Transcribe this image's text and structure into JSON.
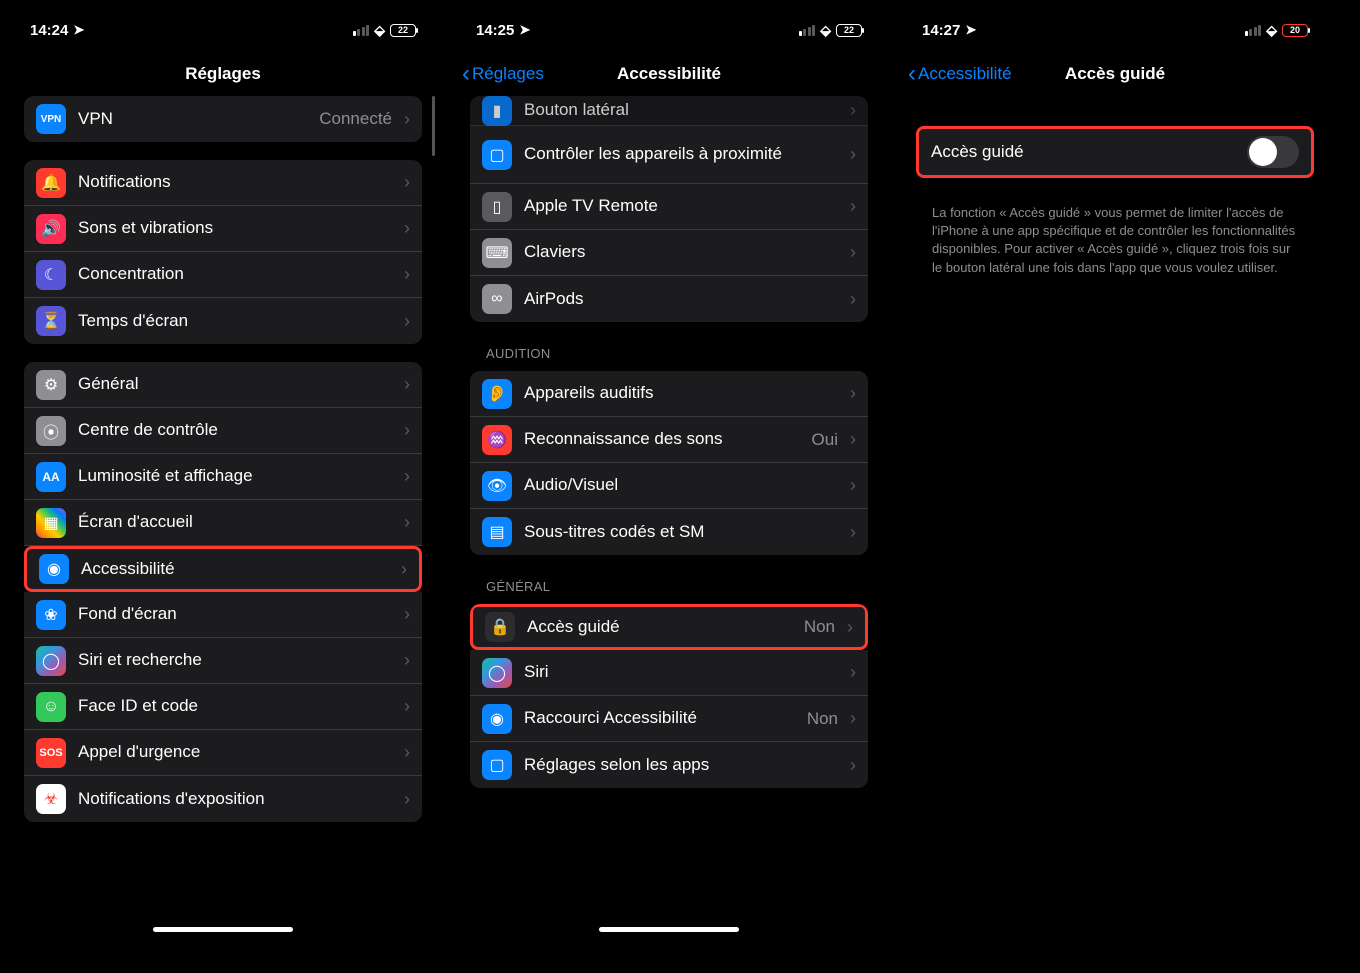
{
  "phones": [
    {
      "time": "14:24",
      "battery": "22",
      "battery_red": false,
      "back": null,
      "title": "Réglages",
      "vpn": {
        "label": "VPN",
        "value": "Connecté"
      },
      "groups": [
        {
          "header": null,
          "rows": [
            {
              "icon": "bell-icon",
              "bg": "bg-red",
              "glyph": "🔔",
              "label": "Notifications"
            },
            {
              "icon": "speaker-icon",
              "bg": "bg-pink",
              "glyph": "🔊",
              "label": "Sons et vibrations"
            },
            {
              "icon": "moon-icon",
              "bg": "bg-purple",
              "glyph": "☾",
              "label": "Concentration"
            },
            {
              "icon": "hourglass-icon",
              "bg": "bg-purple",
              "glyph": "⏳",
              "label": "Temps d'écran"
            }
          ]
        },
        {
          "header": null,
          "rows": [
            {
              "icon": "gear-icon",
              "bg": "bg-gray",
              "glyph": "⚙",
              "label": "Général"
            },
            {
              "icon": "control-center-icon",
              "bg": "bg-gray",
              "glyph": "⦿",
              "label": "Centre de contrôle"
            },
            {
              "icon": "brightness-icon",
              "bg": "bg-blue",
              "glyph": "AA",
              "label": "Luminosité et affichage"
            },
            {
              "icon": "home-screen-icon",
              "bg": "bg-white-dots",
              "glyph": "▦",
              "label": "Écran d'accueil"
            },
            {
              "icon": "accessibility-icon",
              "bg": "bg-blue",
              "glyph": "◉",
              "label": "Accessibilité",
              "highlight": true
            },
            {
              "icon": "wallpaper-icon",
              "bg": "bg-atom",
              "glyph": "❀",
              "label": "Fond d'écran"
            },
            {
              "icon": "siri-icon",
              "bg": "bg-siri",
              "glyph": "◯",
              "label": "Siri et recherche"
            },
            {
              "icon": "faceid-icon",
              "bg": "bg-green",
              "glyph": "☺",
              "label": "Face ID et code"
            },
            {
              "icon": "sos-icon",
              "bg": "bg-sos",
              "glyph": "SOS",
              "label": "Appel d'urgence"
            },
            {
              "icon": "exposure-icon",
              "bg": "bg-red",
              "glyph": "◌",
              "label": "Notifications d'exposition"
            }
          ]
        }
      ]
    },
    {
      "time": "14:25",
      "battery": "22",
      "battery_red": false,
      "back": "Réglages",
      "title": "Accessibilité",
      "vpn": null,
      "groups": [
        {
          "header": null,
          "tight": true,
          "rows": [
            {
              "icon": "side-button-icon",
              "bg": "bg-blue",
              "glyph": "▮",
              "label": "Bouton latéral",
              "partial": true
            },
            {
              "icon": "nearby-icon",
              "bg": "bg-blue",
              "glyph": "▢",
              "label": "Contrôler les appareils\nà proximité",
              "tall": true
            },
            {
              "icon": "tv-remote-icon",
              "bg": "bg-dgray",
              "glyph": "▯",
              "label": "Apple TV Remote"
            },
            {
              "icon": "keyboard-icon",
              "bg": "bg-gray",
              "glyph": "⌨",
              "label": "Claviers"
            },
            {
              "icon": "airpods-icon",
              "bg": "bg-gray",
              "glyph": "∞",
              "label": "AirPods"
            }
          ]
        },
        {
          "header": "AUDITION",
          "rows": [
            {
              "icon": "hearing-icon",
              "bg": "bg-blue",
              "glyph": "👂",
              "label": "Appareils auditifs"
            },
            {
              "icon": "sound-recog-icon",
              "bg": "bg-red",
              "glyph": "♒",
              "label": "Reconnaissance des sons",
              "value": "Oui"
            },
            {
              "icon": "audio-visual-icon",
              "bg": "bg-blue",
              "glyph": "👁",
              "label": "Audio/Visuel"
            },
            {
              "icon": "subtitles-icon",
              "bg": "bg-blue",
              "glyph": "▤",
              "label": "Sous-titres codés et SM"
            }
          ]
        },
        {
          "header": "GÉNÉRAL",
          "rows": [
            {
              "icon": "lock-icon",
              "bg": "bg-black",
              "glyph": "🔒",
              "label": "Accès guidé",
              "value": "Non",
              "highlight": true
            },
            {
              "icon": "siri-icon",
              "bg": "bg-siri",
              "glyph": "◯",
              "label": "Siri"
            },
            {
              "icon": "shortcut-icon",
              "bg": "bg-blue",
              "glyph": "◉",
              "label": "Raccourci Accessibilité",
              "value": "Non"
            },
            {
              "icon": "per-app-icon",
              "bg": "bg-blue",
              "glyph": "▢",
              "label": "Réglages selon les apps"
            }
          ]
        }
      ]
    },
    {
      "time": "14:27",
      "battery": "20",
      "battery_red": true,
      "back": "Accessibilité",
      "title": "Accès guidé",
      "vpn": null,
      "toggle_row": {
        "label": "Accès guidé",
        "on": false
      },
      "desc": "La fonction « Accès guidé » vous permet de limiter l'accès de l'iPhone à une app spécifique et de contrôler les fonctionnalités disponibles. Pour activer « Accès guidé », cliquez trois fois sur le bouton latéral une fois dans l'app que vous voulez utiliser.",
      "groups": []
    }
  ]
}
